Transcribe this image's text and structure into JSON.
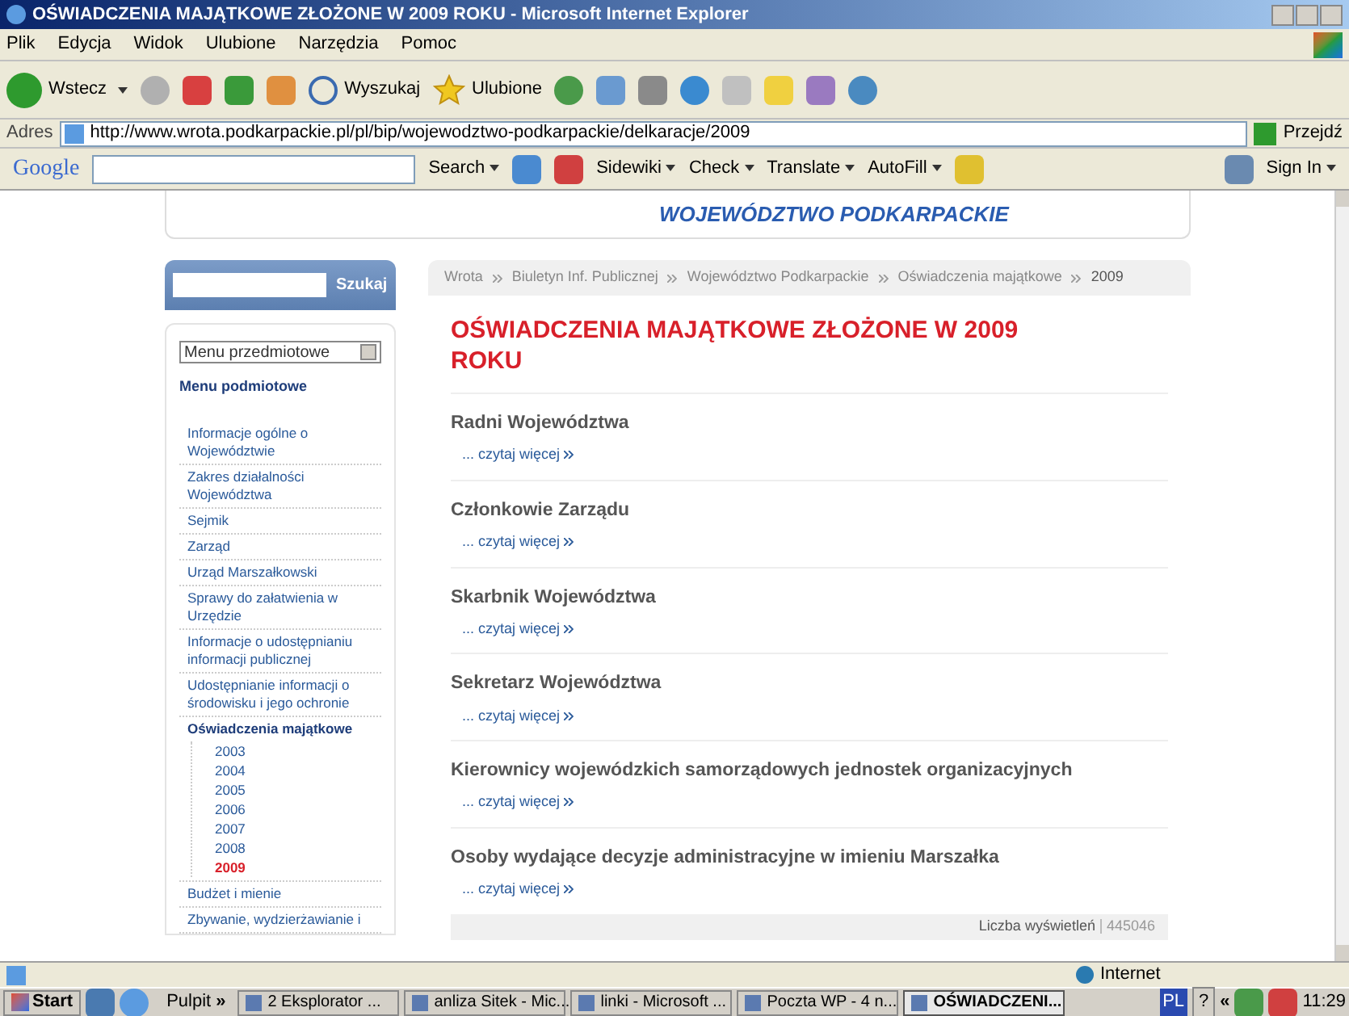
{
  "window": {
    "title": "OŚWIADCZENIA MAJĄTKOWE ZŁOŻONE W 2009 ROKU - Microsoft Internet Explorer"
  },
  "menu_bar": [
    "Plik",
    "Edycja",
    "Widok",
    "Ulubione",
    "Narzędzia",
    "Pomoc"
  ],
  "toolbar": {
    "back": "Wstecz",
    "search": "Wyszukaj",
    "favorites": "Ulubione"
  },
  "address_bar": {
    "label": "Adres",
    "url": "http://www.wrota.podkarpackie.pl/pl/bip/wojewodztwo-podkarpackie/delkaracje/2009",
    "go": "Przejdź"
  },
  "google_bar": {
    "logo": "Google",
    "search": "Search",
    "sidebar": "Sidewiki",
    "check": "Check",
    "translate": "Translate",
    "autofill": "AutoFill",
    "sign_in": "Sign In"
  },
  "page": {
    "header": "WOJEWÓDZTWO PODKARPACKIE",
    "search_button": "Szukaj",
    "subject_menu": "Menu przedmiotowe",
    "menu_heading": "Menu podmiotowe",
    "menu_items": [
      {
        "label": "Informacje ogólne o Województwie",
        "selected": false
      },
      {
        "label": "Zakres działalności Województwa",
        "selected": false
      },
      {
        "label": "Sejmik",
        "selected": false
      },
      {
        "label": "Zarząd",
        "selected": false
      },
      {
        "label": "Urząd Marszałkowski",
        "selected": false
      },
      {
        "label": "Sprawy do załatwienia w Urzędzie",
        "selected": false
      },
      {
        "label": "Informacje o udostępnianiu informacji publicznej",
        "selected": false
      },
      {
        "label": "Udostępnianie informacji o środowisku i jego ochronie",
        "selected": false
      },
      {
        "label": "Oświadczenia majątkowe",
        "selected": true,
        "children": [
          {
            "label": "2003",
            "selected": false
          },
          {
            "label": "2004",
            "selected": false
          },
          {
            "label": "2005",
            "selected": false
          },
          {
            "label": "2006",
            "selected": false
          },
          {
            "label": "2007",
            "selected": false
          },
          {
            "label": "2008",
            "selected": false
          },
          {
            "label": "2009",
            "selected": true
          }
        ]
      },
      {
        "label": "Budżet i mienie",
        "selected": false
      },
      {
        "label": "Zbywanie, wydzierżawianie i",
        "selected": false
      }
    ],
    "breadcrumb": [
      "Wrota",
      "Biuletyn Inf. Publicznej",
      "Województwo Podkarpackie",
      "Oświadczenia majątkowe",
      "2009"
    ],
    "heading": "OŚWIADCZENIA MAJĄTKOWE ZŁOŻONE W 2009 ROKU",
    "sections": [
      {
        "title": "Radni Województwa",
        "link": "... czytaj więcej"
      },
      {
        "title": "Członkowie Zarządu",
        "link": "... czytaj więcej"
      },
      {
        "title": "Skarbnik Województwa",
        "link": "... czytaj więcej"
      },
      {
        "title": "Sekretarz Województwa",
        "link": "... czytaj więcej"
      },
      {
        "title": "Kierownicy wojewódzkich samorządowych jednostek organizacyjnych",
        "link": "... czytaj więcej"
      },
      {
        "title": "Osoby wydające decyzje administracyjne w imieniu Marszałka",
        "link": "... czytaj więcej"
      }
    ],
    "views_label": "Liczba wyświetleń",
    "views": "445046"
  },
  "status_bar": {
    "zone": "Internet"
  },
  "taskbar": {
    "start": "Start",
    "desktop": "Pulpit",
    "chevron": "»",
    "tasks": [
      {
        "label": "2 Eksplorator ...",
        "selected": false
      },
      {
        "label": "anliza Sitek - Mic...",
        "selected": false
      },
      {
        "label": "linki - Microsoft ...",
        "selected": false
      },
      {
        "label": "Poczta WP - 4 n...",
        "selected": false
      },
      {
        "label": "OŚWIADCZENI...",
        "selected": true
      }
    ],
    "lang": "PL",
    "help": "?",
    "tray_chevron": "«",
    "clock": "11:29"
  }
}
